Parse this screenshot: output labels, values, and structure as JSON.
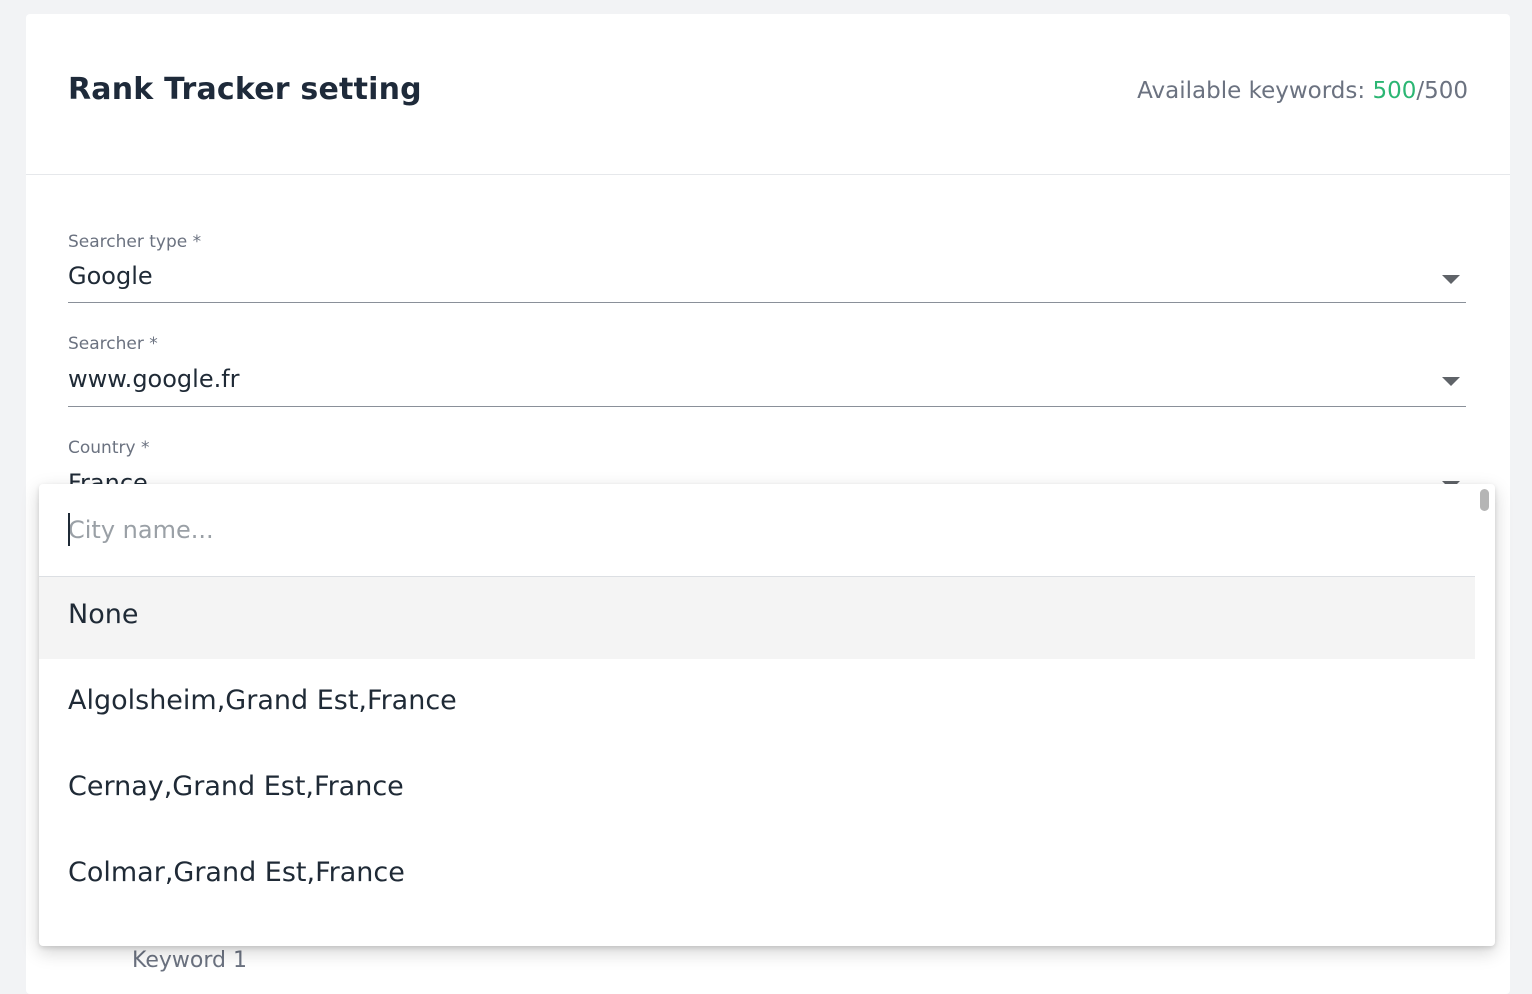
{
  "header": {
    "title": "Rank Tracker setting",
    "quota_label": "Available keywords: ",
    "quota_used": "500",
    "quota_separator": "/",
    "quota_total": "500"
  },
  "form": {
    "searcher_type": {
      "label": "Searcher type *",
      "value": "Google"
    },
    "searcher": {
      "label": "Searcher *",
      "value": "www.google.fr"
    },
    "country": {
      "label": "Country *",
      "value": "France"
    },
    "keyword_label": "Keyword 1"
  },
  "city_dropdown": {
    "search_placeholder": "City name...",
    "search_value": "",
    "options": [
      "None",
      "Algolsheim,Grand Est,France",
      "Cernay,Grand Est,France",
      "Colmar,Grand Est,France"
    ],
    "selected_option": "None"
  },
  "colors": {
    "accent": "#2bb673",
    "text": "#1f2a36",
    "muted": "#6b7280",
    "page_bg": "#f2f3f5"
  }
}
